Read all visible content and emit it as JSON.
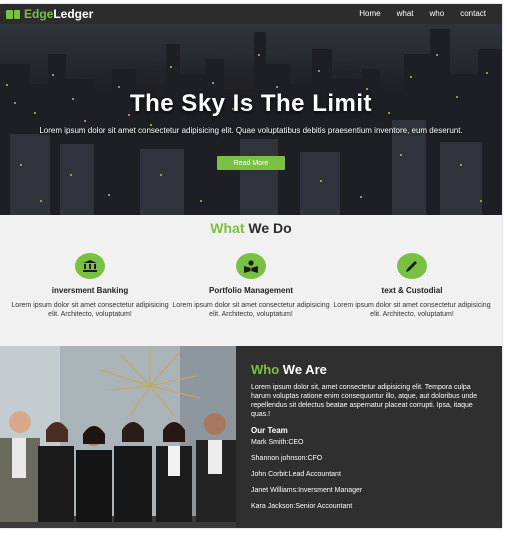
{
  "colors": {
    "accent": "#7ac043",
    "nav_bg": "#2c2c2c",
    "services_bg": "#f1f1f1",
    "who_bg": "#2f2f2f"
  },
  "brand": {
    "first": "Edge",
    "second": "Ledger",
    "icon": "book-logo-icon"
  },
  "nav": {
    "links": [
      "Home",
      "what",
      "who",
      "contact"
    ]
  },
  "hero": {
    "title": "The Sky Is The Limit",
    "text": "Lorem ipsum dolor sit amet consectetur adipisicing elit. Quae voluptatibus debitis praesentium inventore, eum deserunt.",
    "button": "Read More"
  },
  "services": {
    "title_accent": "What",
    "title_rest": "We Do",
    "items": [
      {
        "icon": "bank-icon",
        "title": "inversment Banking",
        "text": "Lorem ipsum dolor sit amet consectetur adipisicing elit. Architecto, voluptatum!"
      },
      {
        "icon": "book-reader-icon",
        "title": "Portfolio Management",
        "text": "Lorem ipsum dolor sit amet consectetur adipisicing elit. Architecto, voluptatum!"
      },
      {
        "icon": "pencil-icon",
        "title": "text & Custodial",
        "text": "Lorem ipsum dolor sit amet consectetur adipisicing elit. Architecto, voluptatum!"
      }
    ]
  },
  "who": {
    "title_accent": "Who",
    "title_rest": "We Are",
    "text": "Lorem ipsum dolor sit, amet consectetur adipisicing elit. Tempora culpa harum voluptas ratione enim consequuntur illo, atque, aut doloribus unde repellendus sit delectus beatae aspernatur placeat corrupti. Ipsa, itaque quas.!",
    "team_heading": "Our Team",
    "members": [
      "Mark Smith:CEO",
      "Shannon johnson:CFO",
      "John Corbit:Lead Accountant",
      "Janet Williams:Inversment Manager",
      "Kara Jackson:Senior Accountant"
    ]
  }
}
